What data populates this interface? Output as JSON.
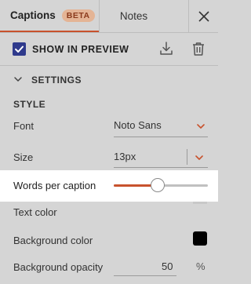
{
  "tabs": {
    "captions_label": "Captions",
    "beta_badge": "BETA",
    "notes_label": "Notes"
  },
  "toolbar": {
    "show_in_preview_label": "SHOW IN PREVIEW",
    "show_in_preview_checked": true
  },
  "settings": {
    "section_label": "SETTINGS",
    "style_label": "STYLE",
    "font": {
      "label": "Font",
      "value": "Noto Sans"
    },
    "size": {
      "label": "Size",
      "value": "13px"
    },
    "words_per_caption": {
      "label": "Words per caption",
      "level": 0.47
    },
    "text_color": {
      "label": "Text color"
    },
    "background_color": {
      "label": "Background color",
      "value": "#000000"
    },
    "background_opacity": {
      "label": "Background opacity",
      "value": "50",
      "unit": "%"
    }
  },
  "colors": {
    "accent": "#c8522d",
    "checkbox": "#2f3a8c",
    "panel_bg": "#d5d5d5",
    "highlight_bg": "#ffffff"
  },
  "icons": [
    "close-icon",
    "checkmark-icon",
    "download-icon",
    "trash-icon",
    "chevron-down-icon"
  ]
}
